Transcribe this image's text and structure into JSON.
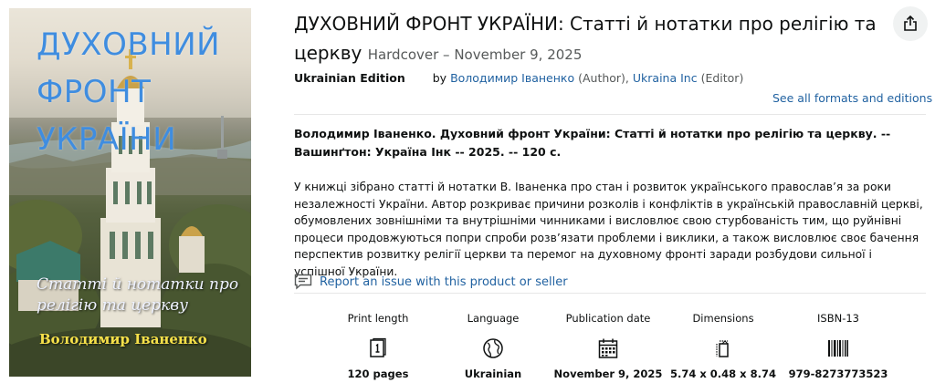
{
  "cover": {
    "title_lines": [
      "ДУХОВНИЙ",
      "ФРОНТ",
      "УКРАЇНИ"
    ],
    "subtitle_lines": [
      "Статті й нотатки про",
      "релігію та церкву"
    ],
    "author": "Володимир Іваненко"
  },
  "product": {
    "title": "ДУХОВНИЙ ФРОНТ УКРАЇНИ: Статті й нотатки про релігію та церкву",
    "format_date": "Hardcover – November 9, 2025",
    "edition": "Ukrainian Edition",
    "by_label": "by",
    "author_name": "Володимир Іваненко",
    "author_role": "(Author),",
    "editor_name": "Ukraina Inc",
    "editor_role": "(Editor)",
    "see_all_formats": "See all formats and editions"
  },
  "bibliographic_note": "Володимир Іваненко. Духовний фронт України: Статті й нотатки про релігію та церкву. -- Вашинґтон: Україна Інк -- 2025. -- 120 с.",
  "description": "У книжці зібрано статті й нотатки В. Іваненка про стан і розвиток українського православ’я за роки незалежності України. Автор розкриває причини розколів і конфліктів в українській православній церкві, обумовлених зовнішніми та внутрішніми чинниками і висловлює свою стурбованість тим, що руйнівні процеси продовжуються попри спроби розв’язати проблеми і виклики, а також висловлює своє бачення перспектив розвитку релігії церкви та перемог на духовному фронті заради розбудови сильної і успішної України.",
  "report_issue": "Report an issue with this product or seller",
  "details": [
    {
      "label": "Print length",
      "value": "120 pages",
      "icon": "pages-icon"
    },
    {
      "label": "Language",
      "value": "Ukrainian",
      "icon": "globe-icon"
    },
    {
      "label": "Publication date",
      "value": "November 9, 2025",
      "icon": "calendar-icon"
    },
    {
      "label": "Dimensions",
      "value": "5.74 x 0.48 x 8.74",
      "icon": "dimensions-icon"
    },
    {
      "label": "ISBN-13",
      "value": "979-8273773523",
      "icon": "barcode-icon"
    }
  ],
  "colors": {
    "link": "#2162a1",
    "text": "#0f1111",
    "cover_title": "#3f8de0",
    "cover_author": "#f7e14a"
  }
}
